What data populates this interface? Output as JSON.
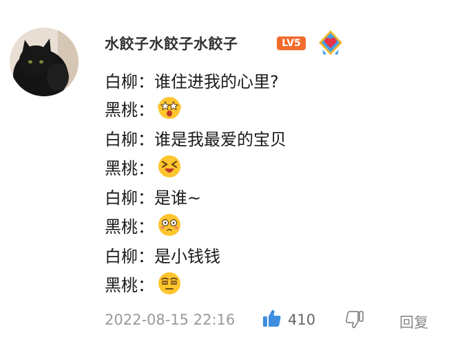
{
  "comment": {
    "username": "水餃子水餃子水餃子",
    "level_badge": "LV5",
    "lines": [
      {
        "speaker": "白柳：",
        "text": "谁住进我的心里?",
        "emoji": null
      },
      {
        "speaker": "黑桃：",
        "text": "",
        "emoji": "starry-eyes-emoji"
      },
      {
        "speaker": "白柳：",
        "text": "谁是我最爱的宝贝",
        "emoji": null
      },
      {
        "speaker": "黑桃：",
        "text": "",
        "emoji": "excited-squint-emoji"
      },
      {
        "speaker": "白柳：",
        "text": "是谁~",
        "emoji": null
      },
      {
        "speaker": "黑桃：",
        "text": "",
        "emoji": "blushing-shy-emoji"
      },
      {
        "speaker": "白柳：",
        "text": "是小钱钱",
        "emoji": null
      },
      {
        "speaker": "黑桃：",
        "text": "",
        "emoji": "money-eyes-emoji"
      }
    ],
    "timestamp": "2022-08-15 22:16",
    "like_count": "410",
    "reply_label": "回复"
  },
  "colors": {
    "like_blue": "#3d8de0",
    "badge_orange": "#f26c2d",
    "emoji_yellow": "#ffc52f"
  }
}
